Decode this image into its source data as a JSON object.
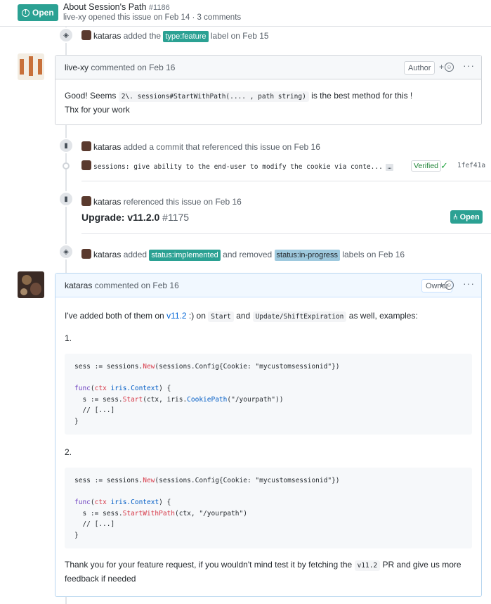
{
  "header": {
    "state": "Open",
    "title": "About Session's Path",
    "number": "#1186",
    "author": "live-xy",
    "meta": "opened this issue on Feb 14 · 3 comments"
  },
  "events": {
    "label_added": {
      "actor": "kataras",
      "pre": "added the",
      "label": "type:feature",
      "post": "label on Feb 15"
    },
    "commit_ref": {
      "actor": "kataras",
      "text": "added a commit that referenced this issue on Feb 16"
    },
    "commit": {
      "message": "sessions: give ability to the end-user to modify the cookie via conte...",
      "more": "…",
      "verified": "Verified",
      "sha": "1fef41a"
    },
    "issue_ref": {
      "actor": "kataras",
      "text": "referenced this issue on Feb 16",
      "title": "Upgrade: v11.2.0",
      "number": "#1175",
      "state": "Open"
    },
    "labels_changed": {
      "actor": "kataras",
      "pre": "added",
      "added_label": "status:implemented",
      "mid": "and removed",
      "removed_label": "status:in-progress",
      "post": "labels on Feb 16"
    }
  },
  "comment1": {
    "author": "live-xy",
    "date": "commented on Feb 16",
    "role": "Author",
    "body_pre": "Good! Seems",
    "code": "2\\. sessions#StartWithPath(.... , path string)",
    "body_post": "is the best method for this !",
    "line2": "Thx for your work"
  },
  "comment2": {
    "author": "kataras",
    "date": "commented on Feb 16",
    "role": "Owner",
    "intro_pre": "I've added both of them on",
    "intro_link": "v11.2",
    "intro_mid": ":) on",
    "code_start": "Start",
    "intro_and": "and",
    "code_update": "Update/ShiftExpiration",
    "intro_post": "as well, examples:",
    "item1": "1.",
    "item2": "2.",
    "outro_pre": "Thank you for your feature request, if you wouldn't mind test it by fetching the",
    "outro_code": "v11.2",
    "outro_post": "PR and give us more feedback if needed"
  },
  "icons": {
    "tag": "tag-icon",
    "bookmark": "bookmark-icon",
    "commit": "commit-icon",
    "smiley": "smiley-icon",
    "kebab": "kebab-icon",
    "check": "check-icon"
  },
  "colors": {
    "accent": "#2ba193",
    "link": "#0366d6",
    "label_light": "#9ec9de"
  }
}
